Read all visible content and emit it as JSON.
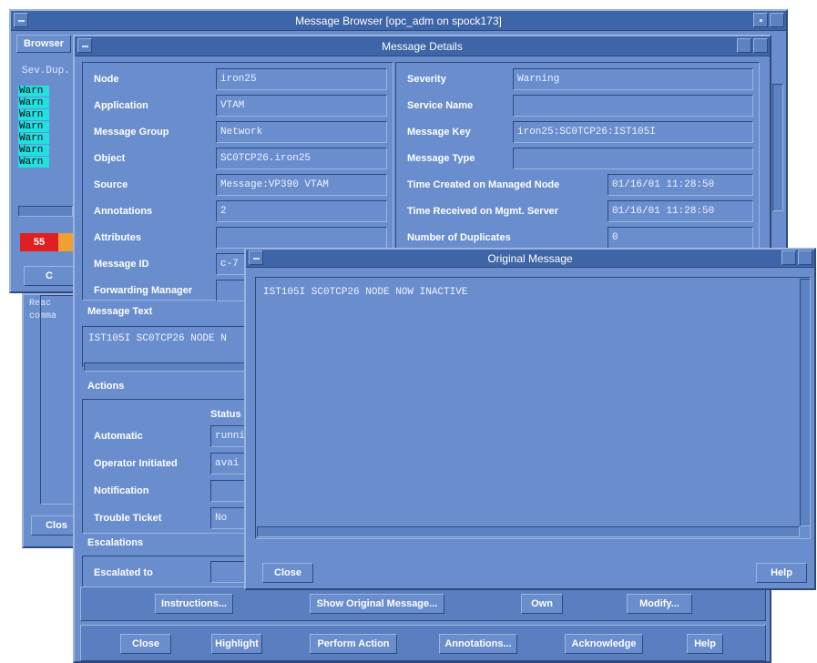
{
  "browser": {
    "title": "Message Browser  [opc_adm on spock173]",
    "menu_label": "Browser",
    "sev_header": "Sev.Dup.",
    "warn_label": "Warn",
    "warn_count": 7,
    "count_red": "55",
    "close_label": "Clos",
    "frag_reac": "Reac",
    "frag_comm": "comma",
    "frag_c": "C"
  },
  "details": {
    "title": "Message Details",
    "left_fields": [
      {
        "label": "Node",
        "value": "iron25"
      },
      {
        "label": "Application",
        "value": "VTAM"
      },
      {
        "label": "Message Group",
        "value": "Network"
      },
      {
        "label": "Object",
        "value": "SC0TCP26.iron25"
      },
      {
        "label": "Source",
        "value": "Message:VP390 VTAM"
      },
      {
        "label": "Annotations",
        "value": "2"
      },
      {
        "label": "Attributes",
        "value": ""
      },
      {
        "label": "Message ID",
        "value": "c-7"
      },
      {
        "label": "Forwarding Manager",
        "value": ""
      }
    ],
    "right_fields": [
      {
        "label": "Severity",
        "value": "Warning"
      },
      {
        "label": "Service Name",
        "value": ""
      },
      {
        "label": "Message Key",
        "value": "iron25:SC0TCP26:IST105I"
      },
      {
        "label": "Message Type",
        "value": ""
      },
      {
        "label": "Time Created on Managed Node",
        "value": "01/16/01 11:28:50"
      },
      {
        "label": "Time Received on Mgmt. Server",
        "value": "01/16/01 11:28:50"
      },
      {
        "label": "Number of Duplicates",
        "value": "0"
      }
    ],
    "message_text_label": "Message Text",
    "message_text": "IST105I  SC0TCP26 NODE N",
    "actions_label": "Actions",
    "status_label": "Status",
    "actions": [
      {
        "label": "Automatic",
        "value": "runni"
      },
      {
        "label": "Operator Initiated",
        "value": "avai"
      },
      {
        "label": "Notification",
        "value": ""
      },
      {
        "label": "Trouble Ticket",
        "value": "No"
      }
    ],
    "escalations_label": "Escalations",
    "escalated_to_label": "Escalated to",
    "escalated_to_value": "",
    "buttons_row1": [
      "Instructions...",
      "Show Original Message...",
      "Own",
      "Modify..."
    ],
    "buttons_row2": [
      "Close",
      "Highlight",
      "Perform Action",
      "Annotations...",
      "Acknowledge",
      "Help"
    ]
  },
  "original": {
    "title": "Original Message",
    "text": "IST105I  SC0TCP26 NODE NOW INACTIVE",
    "close_label": "Close",
    "help_label": "Help"
  }
}
